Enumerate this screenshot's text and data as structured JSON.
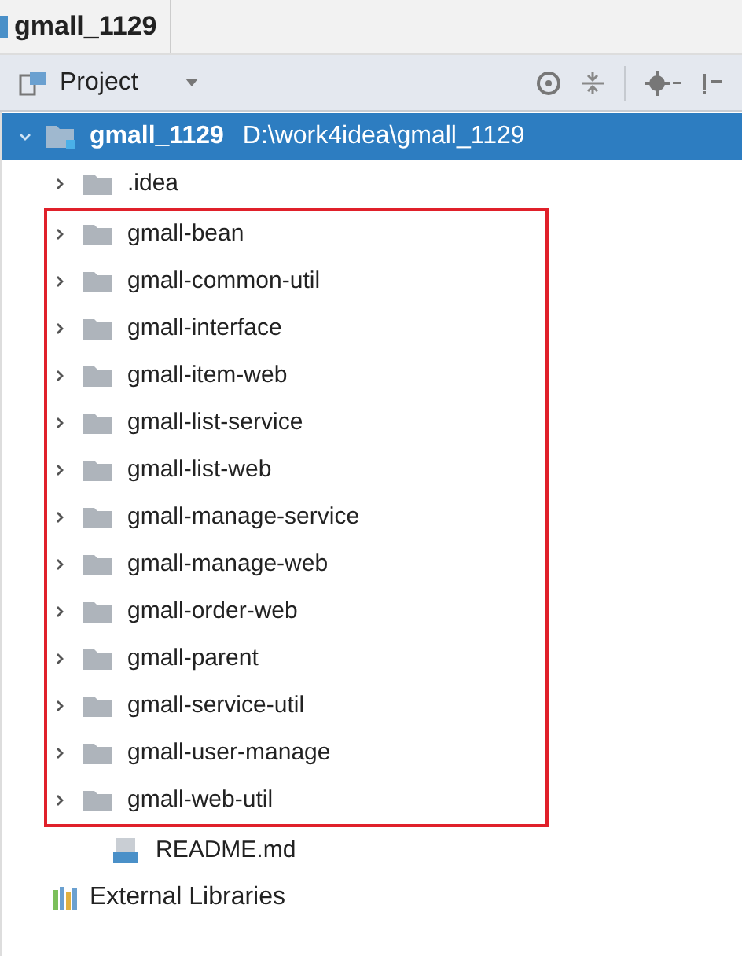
{
  "breadcrumb": {
    "label": "gmall_1129"
  },
  "toolbar": {
    "view": "Project"
  },
  "tree": {
    "label": "gmall_1129",
    "path": "D:\\work4idea\\gmall_1129",
    "selected": true,
    "expanded": true,
    "children": [
      {
        "kind": "folder",
        "label": ".idea",
        "expanded": false,
        "highlighted": false
      },
      {
        "kind": "folder",
        "label": "gmall-bean",
        "expanded": false,
        "highlighted": true
      },
      {
        "kind": "folder",
        "label": "gmall-common-util",
        "expanded": false,
        "highlighted": true
      },
      {
        "kind": "folder",
        "label": "gmall-interface",
        "expanded": false,
        "highlighted": true
      },
      {
        "kind": "folder",
        "label": "gmall-item-web",
        "expanded": false,
        "highlighted": true
      },
      {
        "kind": "folder",
        "label": "gmall-list-service",
        "expanded": false,
        "highlighted": true
      },
      {
        "kind": "folder",
        "label": "gmall-list-web",
        "expanded": false,
        "highlighted": true
      },
      {
        "kind": "folder",
        "label": "gmall-manage-service",
        "expanded": false,
        "highlighted": true
      },
      {
        "kind": "folder",
        "label": "gmall-manage-web",
        "expanded": false,
        "highlighted": true
      },
      {
        "kind": "folder",
        "label": "gmall-order-web",
        "expanded": false,
        "highlighted": true
      },
      {
        "kind": "folder",
        "label": "gmall-parent",
        "expanded": false,
        "highlighted": true
      },
      {
        "kind": "folder",
        "label": "gmall-service-util",
        "expanded": false,
        "highlighted": true
      },
      {
        "kind": "folder",
        "label": "gmall-user-manage",
        "expanded": false,
        "highlighted": true
      },
      {
        "kind": "folder",
        "label": "gmall-web-util",
        "expanded": false,
        "highlighted": true
      },
      {
        "kind": "markdown",
        "label": "README.md"
      }
    ]
  },
  "external": {
    "label": "External Libraries"
  }
}
